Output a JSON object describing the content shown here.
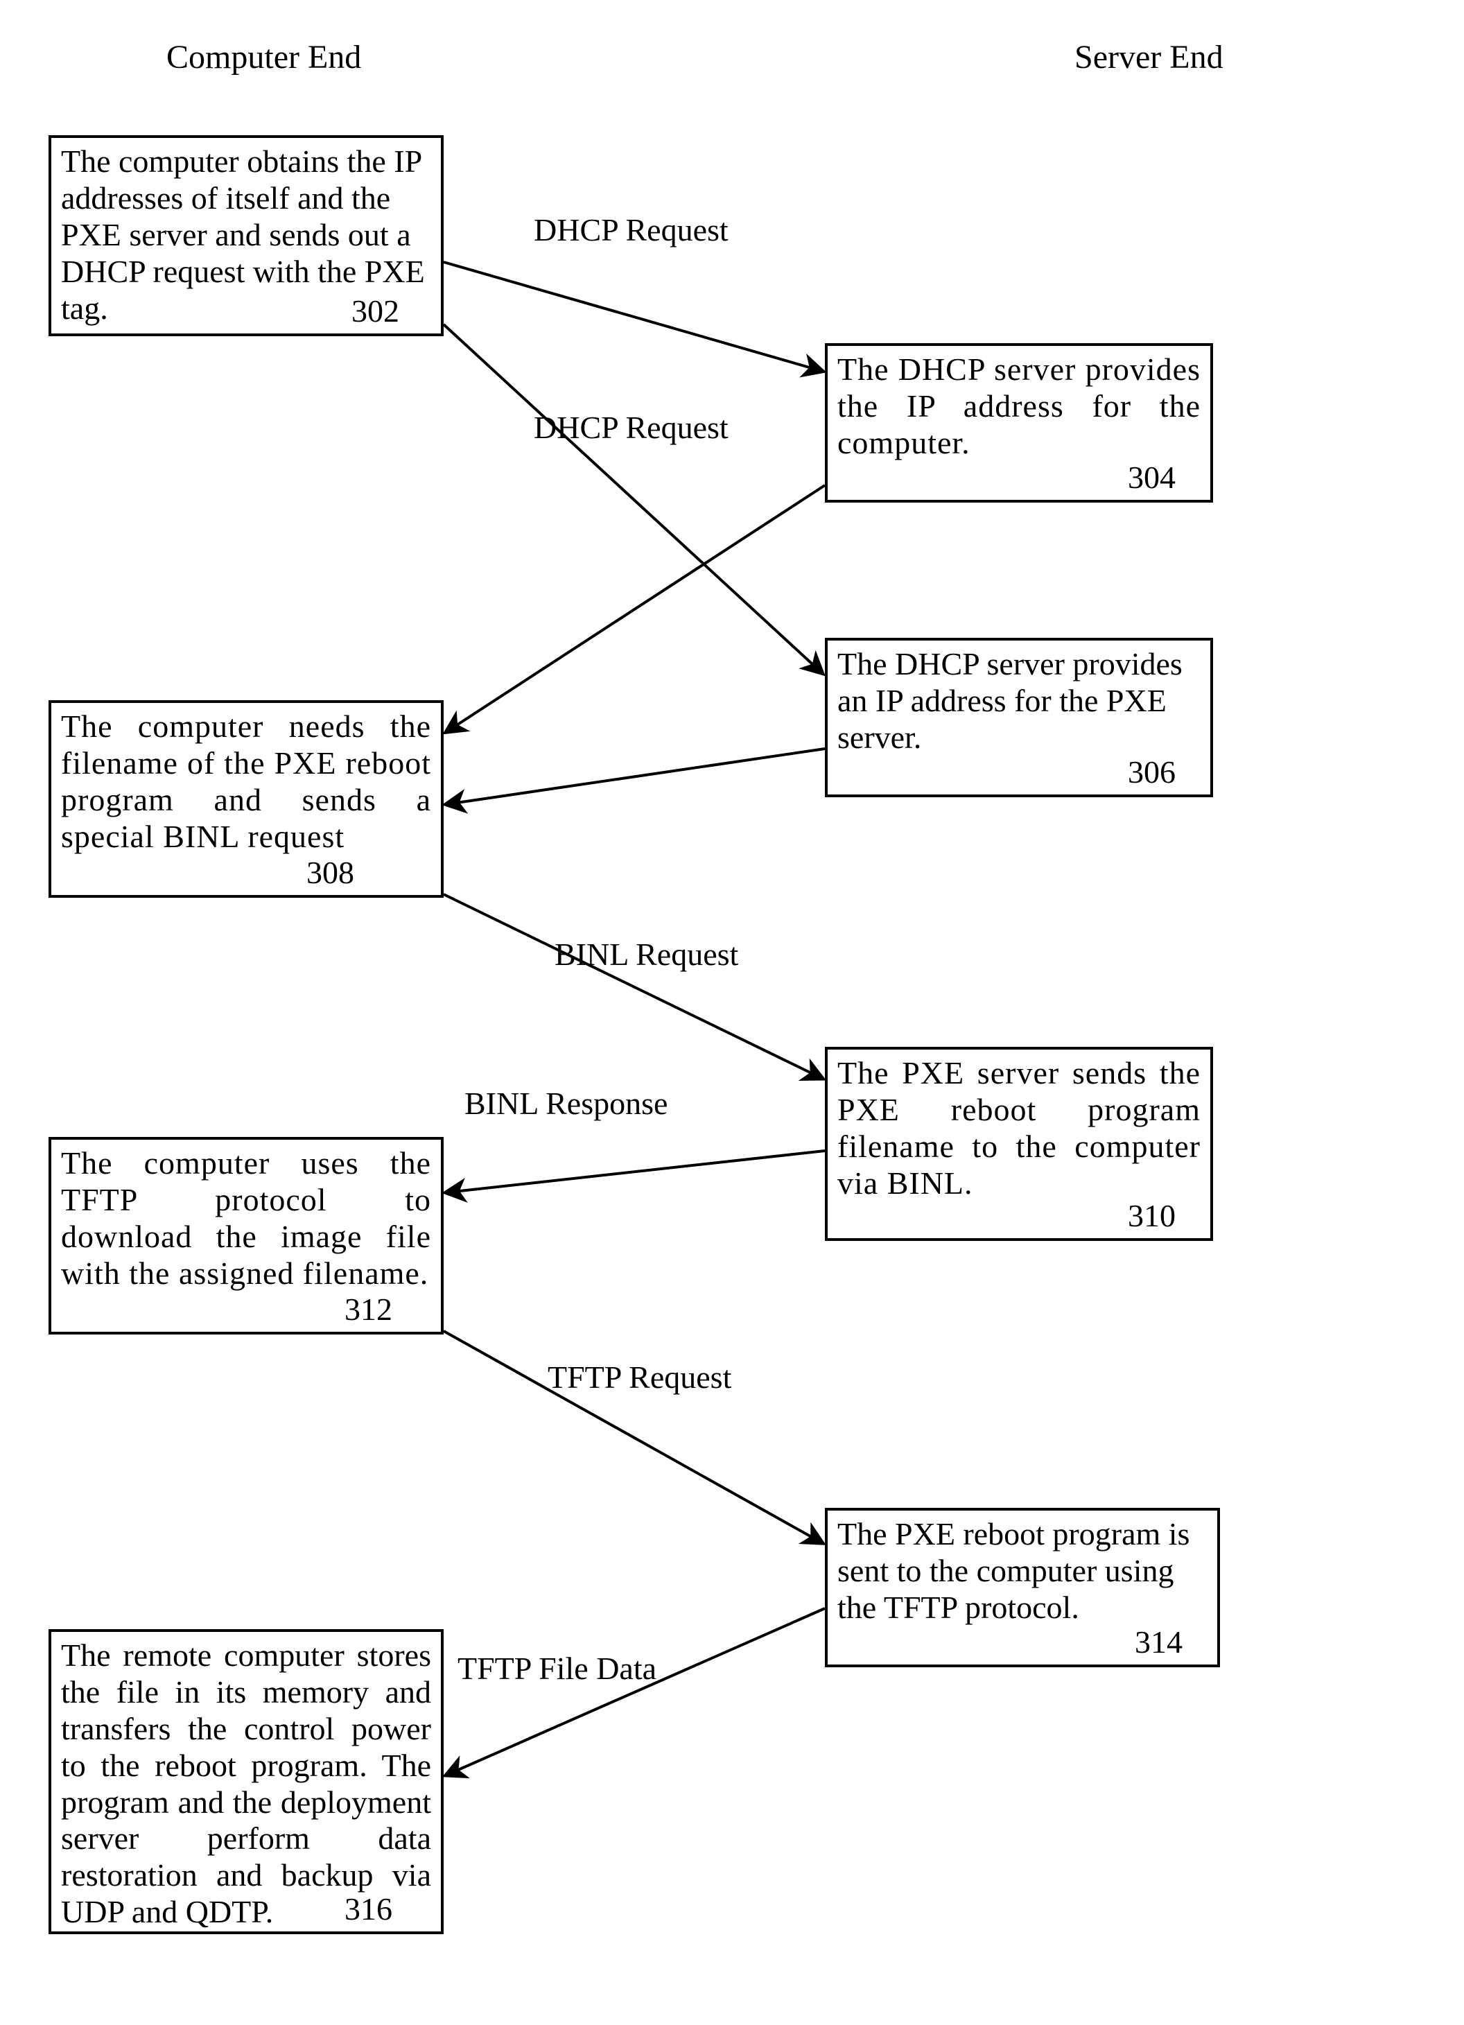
{
  "headers": {
    "left": "Computer End",
    "right": "Server End"
  },
  "nodes": {
    "n302": {
      "text": "The computer obtains the IP addresses of itself and the PXE server and sends out a DHCP request with the PXE tag.",
      "num": "302"
    },
    "n304": {
      "text": "The DHCP server provides the IP address for the computer.",
      "num": "304"
    },
    "n306": {
      "text": "The DHCP server provides an IP address for the PXE server.",
      "num": "306"
    },
    "n308": {
      "text": "The computer needs the filename of the PXE reboot program and sends a special BINL request",
      "num": "308"
    },
    "n310": {
      "text": "The PXE server sends the PXE reboot program filename to the computer via BINL.",
      "num": "310"
    },
    "n312": {
      "text": "The computer uses the TFTP protocol to download the image file with the assigned filename.",
      "num": "312"
    },
    "n314": {
      "text": "The PXE reboot program is sent to the computer using the TFTP protocol.",
      "num": "314"
    },
    "n316": {
      "text": "The remote computer stores the file in its memory and transfers the control power to the reboot program.  The program and the deployment server perform data restoration and backup via UDP and QDTP.",
      "num": "316"
    }
  },
  "edges": {
    "e1": "DHCP Request",
    "e2": "DHCP Request",
    "e3": "BINL Request",
    "e4": "BINL Response",
    "e5": "TFTP Request",
    "e6": "TFTP File Data"
  }
}
